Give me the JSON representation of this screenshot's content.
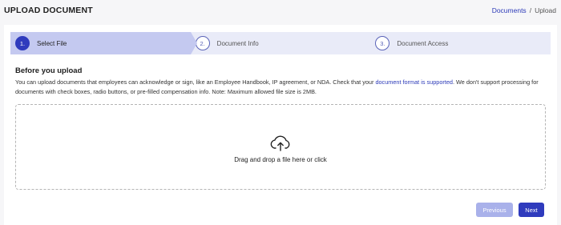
{
  "header": {
    "title": "UPLOAD DOCUMENT",
    "breadcrumb": {
      "link": "Documents",
      "separator": "/",
      "current": "Upload"
    }
  },
  "steps": [
    {
      "number": "1.",
      "label": "Select File",
      "active": true
    },
    {
      "number": "2.",
      "label": "Document Info",
      "active": false
    },
    {
      "number": "3.",
      "label": "Document Access",
      "active": false
    }
  ],
  "intro": {
    "heading": "Before you upload",
    "text_before": "You can upload documents that employees can acknowledge or sign, like an Employee Handbook, IP agreement, or NDA. Check that your ",
    "link": "document format is supported",
    "text_after": ". We don't support processing for documents with check boxes, radio buttons, or pre-filled compensation info. Note: Maximum allowed file size is 2MB."
  },
  "dropzone": {
    "icon": "cloud-upload-icon",
    "text": "Drag and drop a file here or click"
  },
  "buttons": {
    "previous": "Previous",
    "next": "Next"
  },
  "colors": {
    "primary": "#2f3bbd",
    "step_active_bg": "#c4c9f0",
    "step_bg": "#e9ebf8",
    "link": "#2c3ab8",
    "disabled_button": "#a9b1ea"
  }
}
